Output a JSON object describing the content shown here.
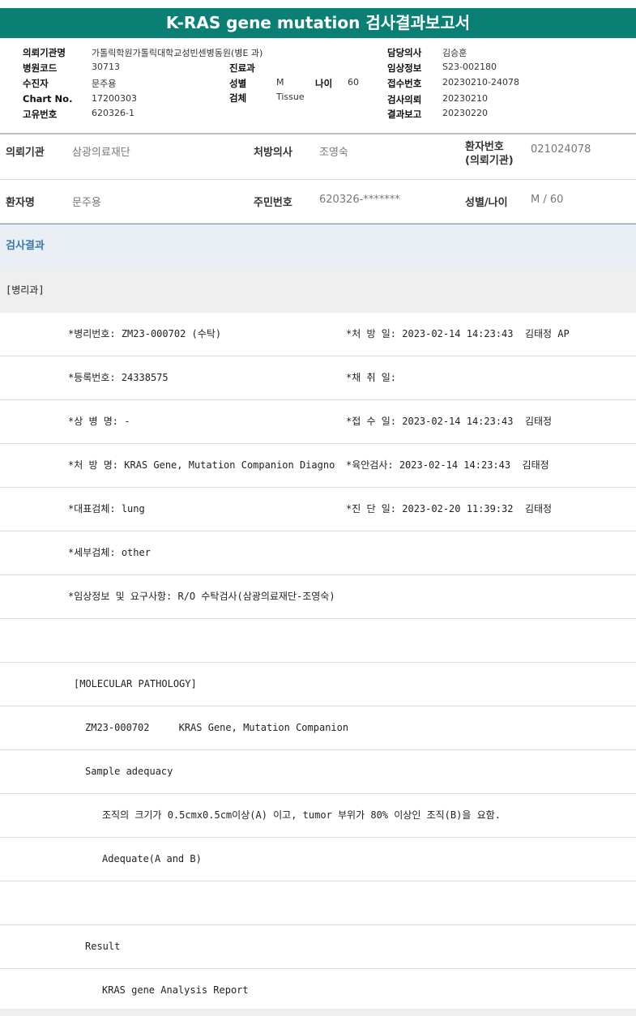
{
  "report_title": "K-RAS gene mutation 검사결과보고서",
  "report_header": {
    "org_label": "의뢰기관명",
    "org_value": "가톨릭학원가톨릭대학교성빈센병동원(병E 과)",
    "hospital_code_label": "병원코드",
    "hospital_code_value": "30713",
    "dept_label": "진료과",
    "dept_value": "",
    "receiver_label": "수진자",
    "receiver_value": "문주용",
    "sex_label": "성별",
    "sex_value": "M",
    "age_label": "나이",
    "age_value": "60",
    "chart_label": "Chart No.",
    "chart_value": "17200303",
    "specimen_label": "검체",
    "specimen_value": "Tissue",
    "unique_label": "고유번호",
    "unique_value": "620326-1",
    "doctor_label": "담당의사",
    "doctor_value": "김승훈",
    "clinical_label": "임상정보",
    "clinical_value": "S23-002180",
    "accession_label": "접수번호",
    "accession_value": "20230210-24078",
    "request_label": "검사의뢰",
    "request_value": "20230210",
    "result_label": "결과보고",
    "result_value": "20230220"
  },
  "patient_info": {
    "institution_label": "의뢰기관",
    "institution_value": "삼광의료재단",
    "prescriber_label": "처방의사",
    "prescriber_value": "조영숙",
    "patient_no_label_line1": "환자번호",
    "patient_no_label_line2": "(의뢰기관)",
    "patient_no_value": "021024078",
    "name_label": "환자명",
    "name_value": "문주용",
    "rrn_label": "주민번호",
    "rrn_value": "620326-*******",
    "sex_age_label": "성별/나이",
    "sex_age_value": "M / 60"
  },
  "section_title": "검사결과",
  "department": "[병리과]",
  "result_rows": [
    {
      "left": "*병리번호: ZM23-000702 (수탁)",
      "right": "*처 방 일: 2023-02-14 14:23:43  김태정 AP"
    },
    {
      "left": "*등록번호: 24338575",
      "right": "*채 취 일:"
    },
    {
      "left": "*상 병 명: -",
      "right": "*접 수 일: 2023-02-14 14:23:43  김태정"
    },
    {
      "left": "*처 방 명: KRAS Gene, Mutation Companion Diagno",
      "right": "*육안검사: 2023-02-14 14:23:43  김태정"
    },
    {
      "left": "*대표검체: lung",
      "right": "*진 단 일: 2023-02-20 11:39:32  김태정"
    },
    {
      "left": "*세부검체: other",
      "right": ""
    },
    {
      "left": "*임상정보 및 요구사항: R/O 수탁검사(삼광의료재단-조영숙)",
      "right": ""
    }
  ],
  "molecular": {
    "header": "[MOLECULAR PATHOLOGY]",
    "case_line": "ZM23-000702     KRAS Gene, Mutation Companion",
    "adequacy_title": "Sample adequacy",
    "adequacy_criteria": "조직의 크기가 0.5cmx0.5cm이상(A) 이고, tumor 부위가 80% 이상인 조직(B)을 요함.",
    "adequacy_result": "Adequate(A and B)",
    "result_title": "Result",
    "result_subtitle": "KRAS gene Analysis Report"
  }
}
